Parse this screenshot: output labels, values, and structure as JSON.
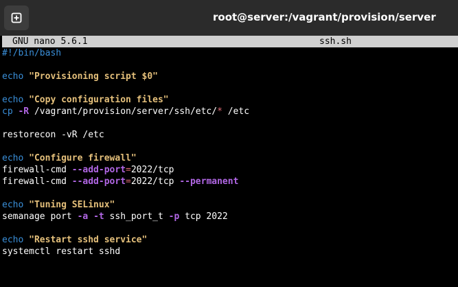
{
  "window": {
    "title": "root@server:/vagrant/provision/server",
    "new_tab_icon": "new-tab-icon"
  },
  "nano": {
    "version": "GNU nano 5.6.1",
    "filename": "ssh.sh"
  },
  "colors": {
    "titlebar": "#2b2b2b",
    "terminal_bg": "#000000",
    "keyword": "#3a8fd9",
    "string": "#e5c07b",
    "flag": "#b267e6",
    "operator": "#e06c75",
    "nano_bar": "#d0d0d0"
  },
  "lines": {
    "l1": {
      "shebang": "#!/bin/bash"
    },
    "l3": {
      "kw": "echo",
      "str": "\"Provisioning script $0\""
    },
    "l5": {
      "kw": "echo",
      "str": "\"Copy configuration files\""
    },
    "l6": {
      "cmd": "cp",
      "flag": "-R",
      "rest_a": " /vagrant/provision/server/ssh/etc/",
      "star": "*",
      "rest_b": " /etc"
    },
    "l8": {
      "text": "restorecon -vR /etc"
    },
    "l10": {
      "kw": "echo",
      "str": "\"Configure firewall\""
    },
    "l11": {
      "cmd": "firewall-cmd ",
      "flag": "--add-port",
      "eq": "=",
      "rest": "2022/tcp"
    },
    "l12": {
      "cmd": "firewall-cmd ",
      "flag": "--add-port",
      "eq": "=",
      "rest": "2022/tcp ",
      "flag2": "--permanent"
    },
    "l14": {
      "kw": "echo",
      "str": "\"Tuning SELinux\""
    },
    "l15": {
      "cmd": "semanage port ",
      "flag_a": "-a",
      "sp1": " ",
      "flag_t": "-t",
      "mid": " ssh_port_t ",
      "flag_p": "-p",
      "rest": " tcp 2022"
    },
    "l17": {
      "kw": "echo",
      "str": "\"Restart sshd service\""
    },
    "l18": {
      "text": "systemctl restart sshd"
    }
  }
}
